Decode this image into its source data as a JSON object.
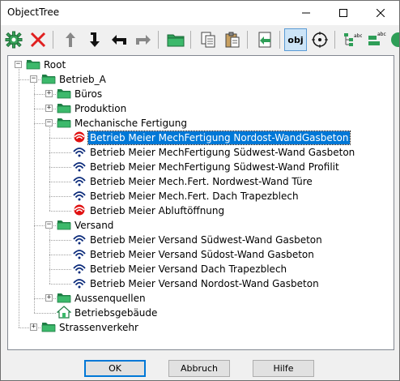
{
  "window": {
    "title": "ObjectTree"
  },
  "toolbar": {
    "items": [
      {
        "name": "settings-gear-icon"
      },
      {
        "name": "delete-x-icon"
      },
      {
        "name": "move-up-arrow-icon"
      },
      {
        "name": "move-down-arrow-icon"
      },
      {
        "name": "back-arrow-icon"
      },
      {
        "name": "forward-arrow-icon"
      },
      {
        "name": "folder-icon"
      },
      {
        "name": "copy-icon"
      },
      {
        "name": "paste-icon"
      },
      {
        "name": "import-icon"
      },
      {
        "name": "obj-toggle-icon",
        "label": "obj",
        "pressed": true
      },
      {
        "name": "target-icon"
      },
      {
        "name": "tree-abc-icon",
        "label": "abc"
      },
      {
        "name": "sort-abc-icon",
        "label": "abc"
      }
    ]
  },
  "tree": {
    "nodes": [
      {
        "label": "Root",
        "icon": "folder",
        "level": 0,
        "expanded": true
      },
      {
        "label": "Betrieb_A",
        "icon": "folder",
        "level": 1,
        "expanded": true
      },
      {
        "label": "Büros",
        "icon": "folder",
        "level": 2,
        "expanded": false
      },
      {
        "label": "Produktion",
        "icon": "folder",
        "level": 2,
        "expanded": false
      },
      {
        "label": "Mechanische Fertigung",
        "icon": "folder",
        "level": 2,
        "expanded": true
      },
      {
        "label": "Betrieb Meier MechFertigung Nordost-WandGasbeton",
        "icon": "sensor-alert",
        "level": 3,
        "selected": true
      },
      {
        "label": "Betrieb Meier MechFertigung Südwest-Wand Gasbeton",
        "icon": "sensor",
        "level": 3
      },
      {
        "label": "Betrieb Meier MechFertigung Südwest-Wand Profilit",
        "icon": "sensor",
        "level": 3
      },
      {
        "label": "Betrieb Meier Mech.Fert. Nordwest-Wand Türe",
        "icon": "sensor",
        "level": 3
      },
      {
        "label": "Betrieb Meier Mech.Fert. Dach Trapezblech",
        "icon": "sensor",
        "level": 3
      },
      {
        "label": "Betrieb Meier Abluftöffnung",
        "icon": "sensor-alert",
        "level": 3
      },
      {
        "label": "Versand",
        "icon": "folder",
        "level": 2,
        "expanded": true
      },
      {
        "label": "Betrieb Meier Versand Südwest-Wand Gasbeton",
        "icon": "sensor",
        "level": 3
      },
      {
        "label": "Betrieb Meier Versand Südost-Wand Gasbeton",
        "icon": "sensor",
        "level": 3
      },
      {
        "label": "Betrieb Meier Versand Dach Trapezblech",
        "icon": "sensor",
        "level": 3
      },
      {
        "label": "Betrieb Meier Versand Nordost-Wand Gasbeton",
        "icon": "sensor",
        "level": 3
      },
      {
        "label": "Aussenquellen",
        "icon": "folder",
        "level": 2,
        "expanded": false
      },
      {
        "label": "Betriebsgebäude",
        "icon": "house",
        "level": 2
      },
      {
        "label": "Strassenverkehr",
        "icon": "folder",
        "level": 1,
        "expanded": false
      }
    ]
  },
  "buttons": {
    "ok": "OK",
    "cancel": "Abbruch",
    "help": "Hilfe"
  },
  "colors": {
    "folder": "#3cb96b",
    "folder_dark": "#1e7d44",
    "selection": "#0078d7",
    "sensor": "#0a2a7a",
    "alert": "#e01010"
  }
}
